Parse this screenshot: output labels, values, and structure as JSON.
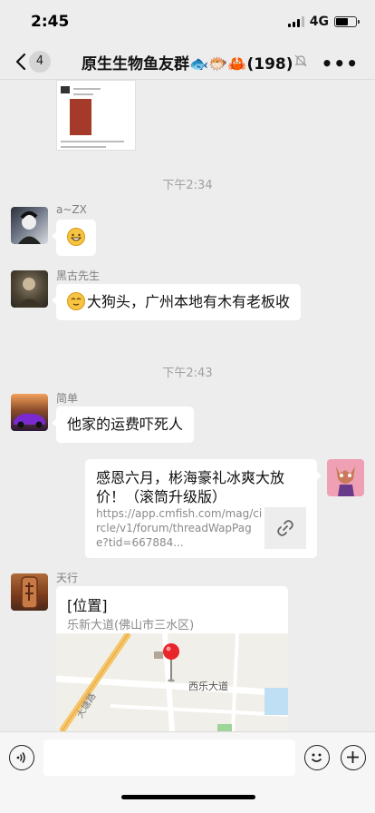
{
  "status": {
    "time": "2:45",
    "network": "4G",
    "battery_level": 0.6
  },
  "nav": {
    "unread_count": "4",
    "title": "原生生物鱼友群🐟🐡🦀(198)",
    "icons": [
      "back-icon",
      "mute-icon",
      "more-icon"
    ]
  },
  "shared_image": {
    "icon": "shared-screenshot-thumbnail"
  },
  "messages": [
    {
      "type": "time",
      "text": "下午2:34"
    },
    {
      "type": "text",
      "sender": "a~ZX",
      "text": "",
      "emoji": "grin-emoji"
    },
    {
      "type": "text",
      "sender": "黑古先生",
      "text": "大狗头，广州本地有木有老板收",
      "emoji": "dog-head-emoji"
    },
    {
      "type": "time",
      "text": "下午2:43"
    },
    {
      "type": "text",
      "sender": "简单",
      "text": "他家的运费吓死人"
    },
    {
      "type": "link",
      "title": "感恩六月，彬海豪礼冰爽大放价！（滚筒升级版）",
      "url": "https://app.cmfish.com/mag/circle/v1/forum/threadWapPage?tid=667884..."
    },
    {
      "type": "location",
      "sender": "天行",
      "title": "[位置]",
      "address": "乐新大道(佛山市三水区)",
      "map_labels": [
        "西乐大道",
        "大塘路"
      ]
    }
  ],
  "input": {
    "placeholder": "",
    "icons": [
      "voice-icon",
      "emoji-face-icon",
      "plus-icon"
    ]
  },
  "colors": {
    "background": "#ededed",
    "bubble": "#ffffff",
    "map_pin": "#e8262a"
  }
}
